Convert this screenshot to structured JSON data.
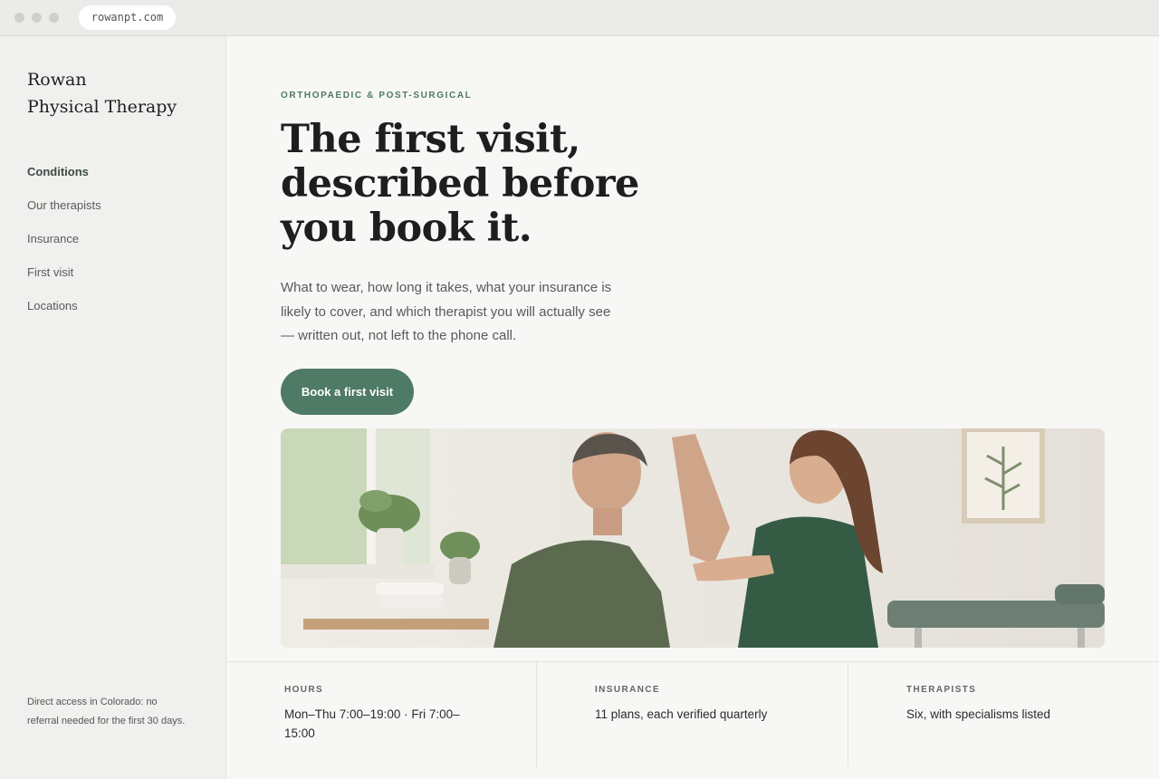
{
  "browser": {
    "url": "rowanpt.com"
  },
  "sidebar": {
    "brand_line1": "Rowan",
    "brand_line2": "Physical Therapy",
    "nav": [
      {
        "label": "Conditions",
        "active": true
      },
      {
        "label": "Our therapists",
        "active": false
      },
      {
        "label": "Insurance",
        "active": false
      },
      {
        "label": "First visit",
        "active": false
      },
      {
        "label": "Locations",
        "active": false
      }
    ],
    "note": "Direct access in Colorado: no referral needed for the first 30 days."
  },
  "hero": {
    "eyebrow": "ORTHOPAEDIC & POST-SURGICAL",
    "headline": "The first visit, described before you book it.",
    "lede": "What to wear, how long it takes, what your insurance is likely to cover, and which therapist you will actually see — written out, not left to the phone call.",
    "cta_label": "Book a first visit",
    "photo_icon": "therapy-session-photo"
  },
  "info": [
    {
      "label": "HOURS",
      "value": "Mon–Thu 7:00–19:00 · Fri 7:00–15:00"
    },
    {
      "label": "INSURANCE",
      "value": "11 plans, each verified quarterly"
    },
    {
      "label": "THERAPISTS",
      "value": "Six, with specialisms listed"
    }
  ],
  "colors": {
    "accent": "#4e7a66",
    "background": "#f7f7f5",
    "sidebar": "#f0f0ee"
  }
}
